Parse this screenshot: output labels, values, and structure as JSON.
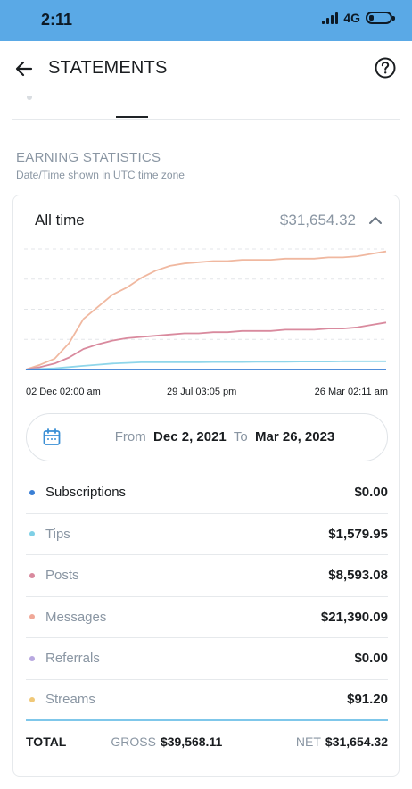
{
  "status_bar": {
    "time": "2:11",
    "network": "4G",
    "battery_level": 0.2
  },
  "header": {
    "title": "STATEMENTS",
    "back_icon": "arrow-left-icon",
    "help_icon": "question-circle-icon"
  },
  "section": {
    "title": "EARNING STATISTICS",
    "subtitle": "Date/Time shown in UTC time zone"
  },
  "card": {
    "period_label": "All time",
    "period_total": "$31,654.32",
    "collapse_icon": "chevron-up-icon",
    "x_labels": [
      "02 Dec 02:00 am",
      "29 Jul 03:05 pm",
      "26 Mar 02:11 am"
    ],
    "date_range": {
      "from_label": "From",
      "from": "Dec 2, 2021",
      "to_label": "To",
      "to": "Mar 26, 2023"
    },
    "breakdown": [
      {
        "name": "Subscriptions",
        "amount": "$0.00",
        "color": "#3a7fd5"
      },
      {
        "name": "Tips",
        "amount": "$1,579.95",
        "color": "#7fd0e6"
      },
      {
        "name": "Posts",
        "amount": "$8,593.08",
        "color": "#d98a9e"
      },
      {
        "name": "Messages",
        "amount": "$21,390.09",
        "color": "#f0a898"
      },
      {
        "name": "Referrals",
        "amount": "$0.00",
        "color": "#b8a8e0"
      },
      {
        "name": "Streams",
        "amount": "$91.20",
        "color": "#f0c878"
      }
    ],
    "totals": {
      "label": "TOTAL",
      "gross_label": "GROSS",
      "gross": "$39,568.11",
      "net_label": "NET",
      "net": "$31,654.32"
    }
  },
  "chart_data": {
    "type": "line",
    "x": [
      0,
      0.04,
      0.08,
      0.12,
      0.16,
      0.2,
      0.24,
      0.28,
      0.32,
      0.36,
      0.4,
      0.44,
      0.48,
      0.52,
      0.56,
      0.6,
      0.64,
      0.68,
      0.72,
      0.76,
      0.8,
      0.84,
      0.88,
      0.92,
      0.96,
      1.0
    ],
    "series": [
      {
        "name": "Messages",
        "color": "#f0b8a0",
        "values": [
          0,
          0.04,
          0.09,
          0.22,
          0.42,
          0.52,
          0.62,
          0.68,
          0.76,
          0.82,
          0.86,
          0.88,
          0.89,
          0.9,
          0.9,
          0.91,
          0.91,
          0.91,
          0.92,
          0.92,
          0.92,
          0.93,
          0.93,
          0.94,
          0.96,
          0.98
        ]
      },
      {
        "name": "Posts",
        "color": "#d98a9e",
        "values": [
          0,
          0.02,
          0.05,
          0.1,
          0.17,
          0.21,
          0.24,
          0.26,
          0.27,
          0.28,
          0.29,
          0.3,
          0.3,
          0.31,
          0.31,
          0.32,
          0.32,
          0.32,
          0.33,
          0.33,
          0.33,
          0.34,
          0.34,
          0.35,
          0.37,
          0.39
        ]
      },
      {
        "name": "Tips",
        "color": "#8fd6ea",
        "values": [
          0,
          0.005,
          0.01,
          0.02,
          0.03,
          0.04,
          0.05,
          0.055,
          0.06,
          0.06,
          0.06,
          0.06,
          0.06,
          0.062,
          0.062,
          0.062,
          0.064,
          0.064,
          0.064,
          0.066,
          0.066,
          0.066,
          0.068,
          0.068,
          0.068,
          0.068
        ]
      },
      {
        "name": "Subscriptions",
        "color": "#3a7fd5",
        "values": [
          0,
          0,
          0,
          0,
          0,
          0,
          0,
          0,
          0,
          0,
          0,
          0,
          0,
          0,
          0,
          0,
          0,
          0,
          0,
          0,
          0,
          0,
          0,
          0,
          0,
          0
        ]
      }
    ],
    "ylim": [
      0,
      1
    ],
    "grid": true
  }
}
